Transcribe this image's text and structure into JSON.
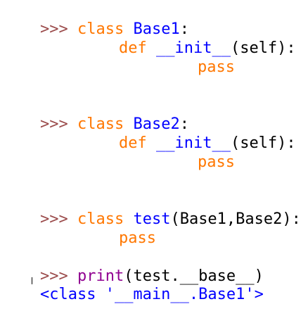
{
  "shell": {
    "prompt": ">>>",
    "line1": {
      "kw": "class",
      "name": "Base1",
      "tail": ":"
    },
    "line2": {
      "kw": "def",
      "name": "__init__",
      "tail": "(self):"
    },
    "line3": {
      "kw": "pass"
    },
    "line4": {
      "kw": "class",
      "name": "Base2",
      "tail": ":"
    },
    "line5": {
      "kw": "def",
      "name": "__init__",
      "tail": "(self):"
    },
    "line6": {
      "kw": "pass"
    },
    "line7": {
      "kw": "class",
      "name": "test",
      "tail": "(Base1,Base2):"
    },
    "line8": {
      "kw": "pass"
    },
    "line9": {
      "builtin": "print",
      "tail": "(test.__base__)"
    },
    "output": "<class '__main__.Base1'>"
  },
  "colors": {
    "prompt": "#9b4b4b",
    "keyword": "#ff7700",
    "definition": "#0000ff",
    "builtin": "#900090",
    "output": "#0000ff"
  }
}
